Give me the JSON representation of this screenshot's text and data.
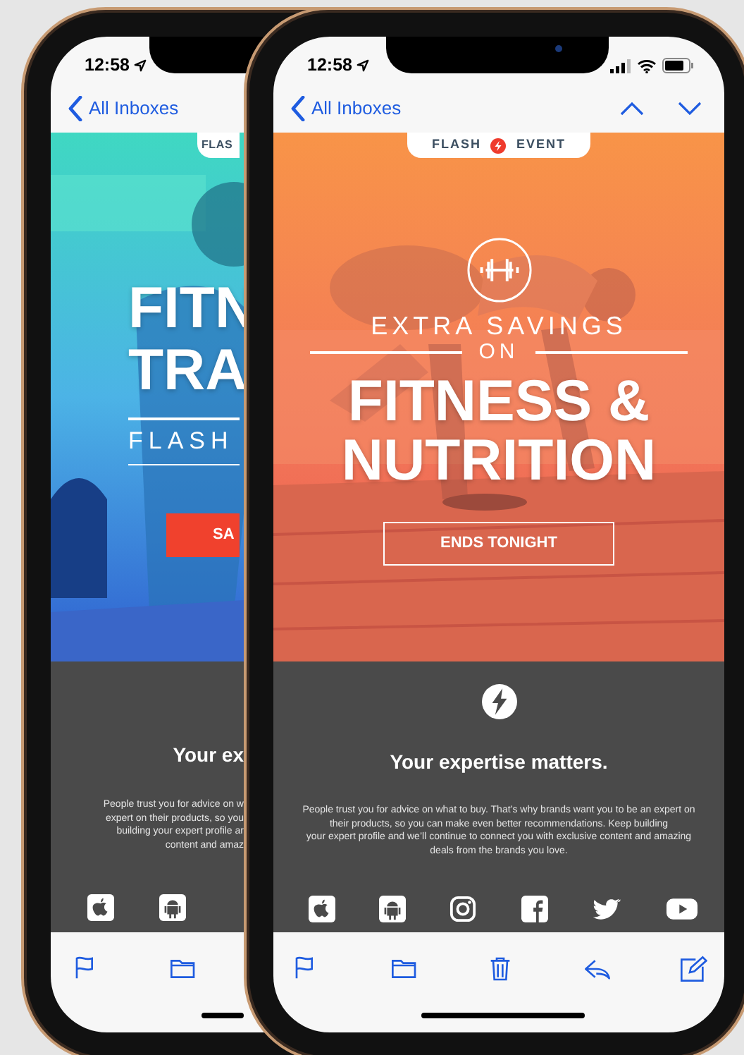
{
  "back_phone": {
    "status": {
      "time": "12:58"
    },
    "nav": {
      "back": "All Inboxes"
    },
    "hero": {
      "kind": "picture",
      "badge": "FLAS",
      "headline": [
        "FITN",
        "TRA"
      ],
      "subline": "FLASH",
      "cta": "SA"
    },
    "footer": {
      "heading": "Your ex",
      "paragraph_lines": [
        {
          "before": "People trust you for advice on w"
        },
        {
          "before": "expert on their products, so you"
        },
        {
          "before": "building ",
          "link": "your expert profile",
          "after": " ar"
        },
        {
          "before": "content and amaz"
        }
      ],
      "app_icons": [
        {
          "kind": "apple"
        },
        {
          "kind": "android"
        }
      ]
    },
    "toolbar": [
      {
        "kind": "flag"
      },
      {
        "kind": "folder"
      }
    ]
  },
  "front_phone": {
    "status": {
      "time": "12:58"
    },
    "nav": {
      "back": "All Inboxes"
    },
    "hero": {
      "kind": "picture",
      "badge": {
        "left": "FLASH",
        "right": "EVENT"
      },
      "eyebrow": "EXTRA SAVINGS",
      "connector": "ON",
      "headline": [
        "FITNESS &",
        "NUTRITION"
      ],
      "cta": "ENDS TONIGHT"
    },
    "footer": {
      "heading": "Your expertise matters.",
      "paragraph": {
        "before": "People trust you for advice on what to buy. That’s why brands want you to be an expert on their products, so you can make even better recommendations. Keep building ",
        "link": "your expert profile",
        "after": " and we’ll continue to connect you with exclusive content and amazing deals from the brands you love."
      },
      "app_icons": [
        {
          "kind": "apple"
        },
        {
          "kind": "android"
        },
        {
          "kind": "instagram"
        },
        {
          "kind": "facebook"
        },
        {
          "kind": "twitter"
        },
        {
          "kind": "youtube"
        }
      ]
    },
    "toolbar": [
      {
        "kind": "flag"
      },
      {
        "kind": "folder"
      },
      {
        "kind": "trash"
      },
      {
        "kind": "reply"
      },
      {
        "kind": "compose"
      }
    ]
  }
}
